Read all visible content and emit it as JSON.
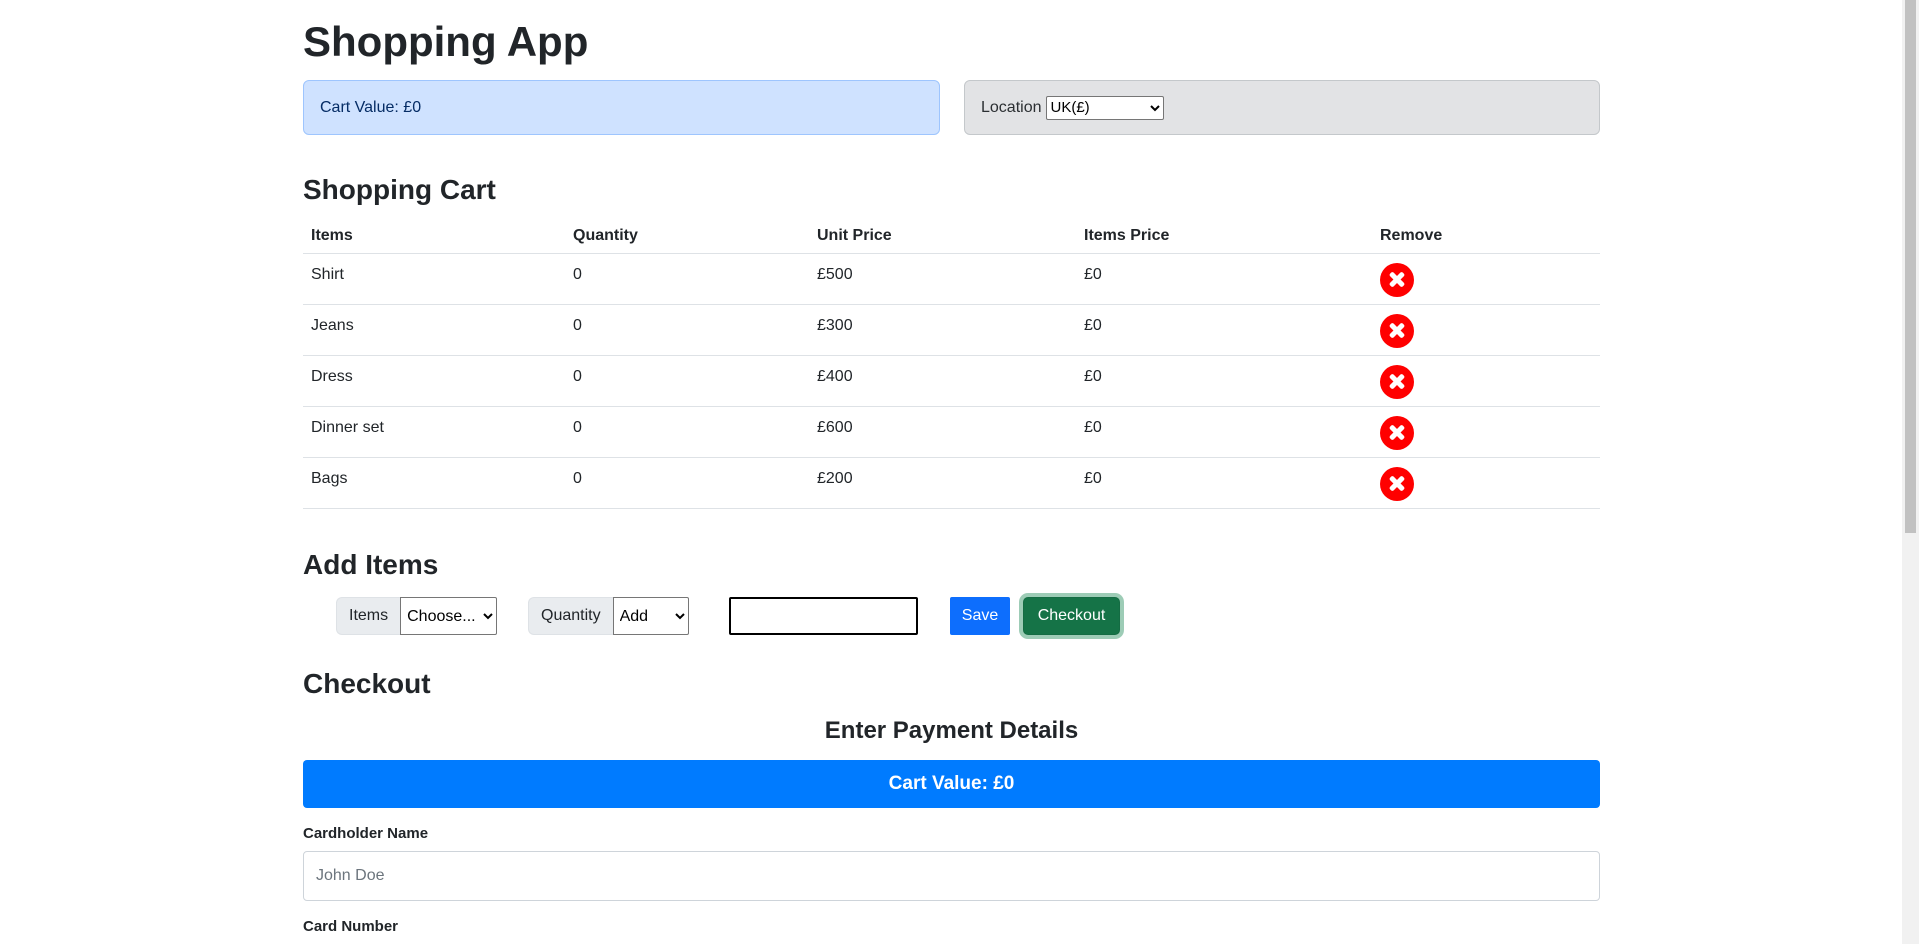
{
  "app": {
    "title": "Shopping App"
  },
  "cart_alert": {
    "label": "Cart Value: £0"
  },
  "location": {
    "label": "Location",
    "selected": "UK(£)"
  },
  "shopping_cart": {
    "title": "Shopping Cart",
    "headers": [
      "Items",
      "Quantity",
      "Unit Price",
      "Items Price",
      "Remove"
    ],
    "rows": [
      {
        "item": "Shirt",
        "quantity": "0",
        "unit_price": "£500",
        "items_price": "£0"
      },
      {
        "item": "Jeans",
        "quantity": "0",
        "unit_price": "£300",
        "items_price": "£0"
      },
      {
        "item": "Dress",
        "quantity": "0",
        "unit_price": "£400",
        "items_price": "£0"
      },
      {
        "item": "Dinner set",
        "quantity": "0",
        "unit_price": "£600",
        "items_price": "£0"
      },
      {
        "item": "Bags",
        "quantity": "0",
        "unit_price": "£200",
        "items_price": "£0"
      }
    ],
    "remove_icon": "x-circle-icon",
    "remove_color": "#ff0000"
  },
  "add_items": {
    "title": "Add Items",
    "items_label": "Items",
    "items_selected": "Choose...",
    "quantity_label": "Quantity",
    "quantity_selected": "Add",
    "quantity_value": "",
    "save_label": "Save",
    "checkout_label": "Checkout"
  },
  "checkout": {
    "title": "Checkout",
    "payment_title": "Enter Payment Details",
    "cart_value": "Cart Value: £0",
    "cardholder_label": "Cardholder Name",
    "cardholder_placeholder": "John Doe",
    "card_number_label": "Card Number"
  },
  "colors": {
    "primary": "#0d6efd",
    "banner": "#007bff",
    "success": "#157347",
    "info_bg": "#cfe2ff",
    "secondary_bg": "#e2e3e5"
  }
}
